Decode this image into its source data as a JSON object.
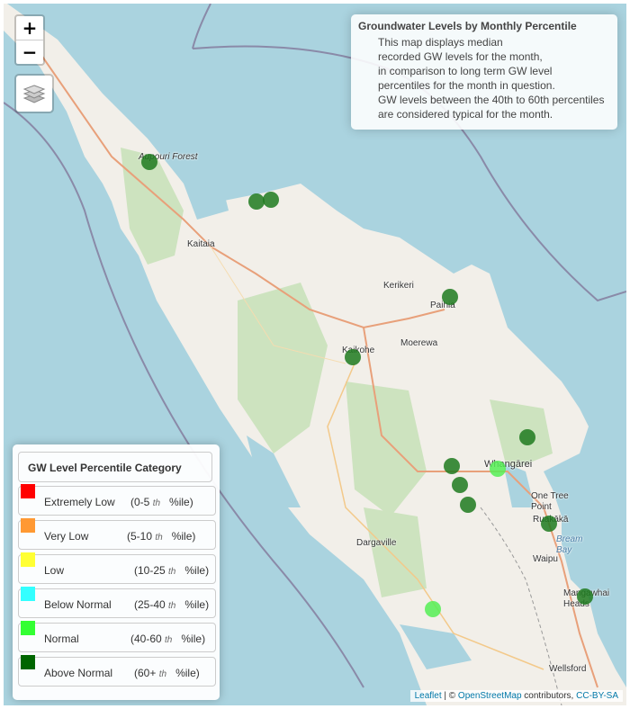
{
  "controls": {
    "zoom_in": "+",
    "zoom_out": "−"
  },
  "info": {
    "title": "Groundwater Levels by Monthly Percentile",
    "lines": [
      "This map displays median",
      "recorded GW levels for the month,",
      "in comparison to long term GW level",
      "percentiles for the month in question.",
      "GW levels between the 40th to 60th percentiles",
      "are considered typical for the month."
    ]
  },
  "legend": {
    "title": "GW Level Percentile Category",
    "items": [
      {
        "label": "Extremely Low",
        "range_start": "(0-5",
        "th": "th",
        "range_end": "%ile)",
        "color": "#ff0000"
      },
      {
        "label": "Very Low",
        "range_start": "(5-10",
        "th": "th",
        "range_end": "%ile)",
        "color": "#ff9933"
      },
      {
        "label": "Low",
        "range_start": "(10-25",
        "th": "th",
        "range_end": "%ile)",
        "color": "#ffff33"
      },
      {
        "label": "Below Normal",
        "range_start": "(25-40",
        "th": "th",
        "range_end": "%ile)",
        "color": "#33ffff"
      },
      {
        "label": "Normal",
        "range_start": "(40-60",
        "th": "th",
        "range_end": "%ile)",
        "color": "#33ff33"
      },
      {
        "label": "Above Normal",
        "range_start": "(60+",
        "th": "th",
        "range_end": "%ile)",
        "color": "#006600"
      }
    ]
  },
  "places": {
    "kaitaia": "Kaitaia",
    "kerikeri": "Kerikeri",
    "paihia": "Paihia",
    "kaikohe": "Kaikohe",
    "moerewa": "Moerewa",
    "whangarei": "Whangārei",
    "one_tree_point": "One Tree\nPoint",
    "ruakaka": "Ruakākā",
    "bream_bay": "Bream\nBay",
    "waipu": "Waipu",
    "dargaville": "Dargaville",
    "mangawhai_heads": "Mangawhai\nHeads",
    "wellsford": "Wellsford",
    "aupouri": "Aupouri\nForest"
  },
  "sites": [
    {
      "category": "Above Normal",
      "color": "#1f7a1f"
    },
    {
      "category": "Above Normal",
      "color": "#1f7a1f"
    },
    {
      "category": "Above Normal",
      "color": "#1f7a1f"
    },
    {
      "category": "Above Normal",
      "color": "#1f7a1f"
    },
    {
      "category": "Above Normal",
      "color": "#1f7a1f"
    },
    {
      "category": "Above Normal",
      "color": "#1f7a1f"
    },
    {
      "category": "Above Normal",
      "color": "#1f7a1f"
    },
    {
      "category": "Above Normal",
      "color": "#1f7a1f"
    },
    {
      "category": "Above Normal",
      "color": "#1f7a1f"
    },
    {
      "category": "Normal",
      "color": "#55ee55"
    },
    {
      "category": "Above Normal",
      "color": "#1f7a1f"
    },
    {
      "category": "Above Normal",
      "color": "#1f7a1f"
    },
    {
      "category": "Normal",
      "color": "#55ee55"
    }
  ],
  "attribution": {
    "leaflet": "Leaflet",
    "sep": " | © ",
    "osm": "OpenStreetMap",
    "contrib": " contributors, ",
    "license": "CC-BY-SA"
  }
}
